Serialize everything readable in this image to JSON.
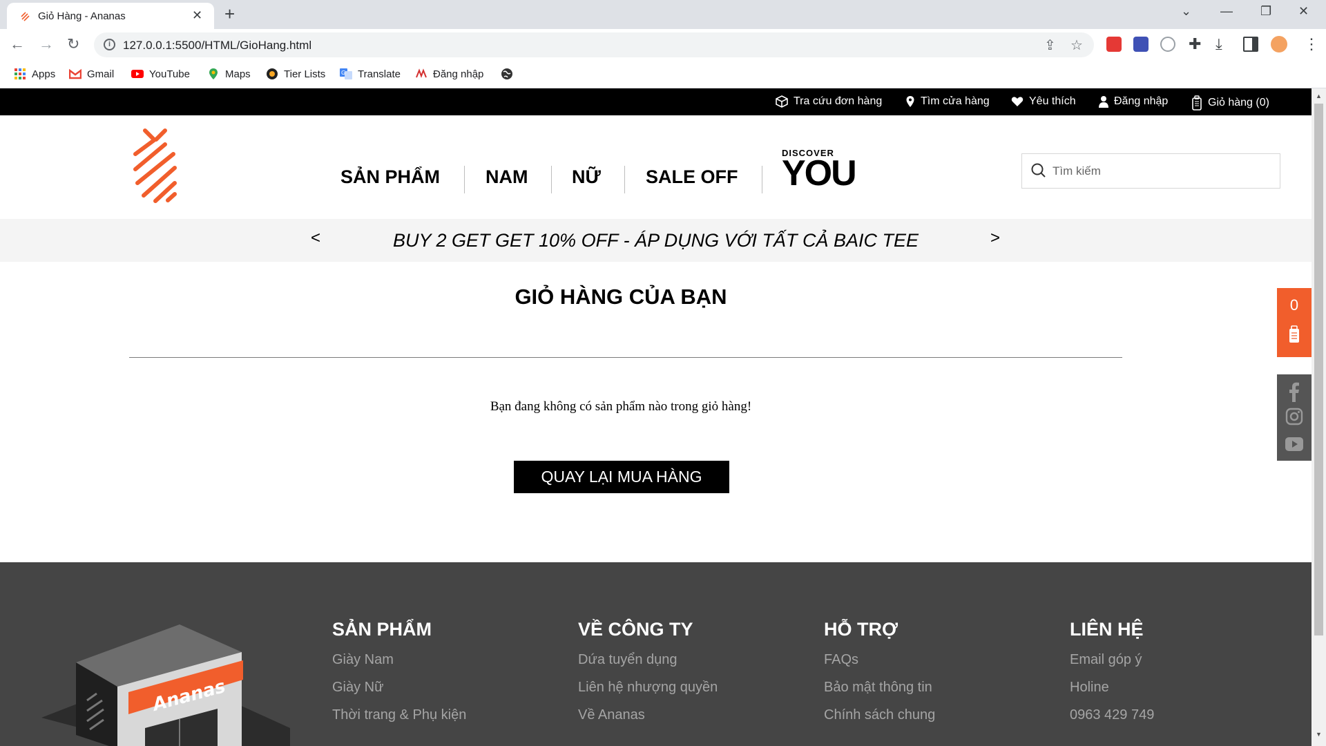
{
  "browser": {
    "tab_title": "Giỏ Hàng - Ananas",
    "url": "127.0.0.1:5500/HTML/GioHang.html",
    "bookmarks": [
      "Apps",
      "Gmail",
      "YouTube",
      "Maps",
      "Tier Lists",
      "Translate",
      "Đăng nhập"
    ]
  },
  "topbar": {
    "order_lookup": "Tra cứu đơn hàng",
    "find_store": "Tìm cửa hàng",
    "favorites": "Yêu thích",
    "login": "Đăng nhập",
    "cart": "Giỏ hàng (0)"
  },
  "nav": {
    "items": [
      "SẢN PHẨM",
      "NAM",
      "NỮ",
      "SALE OFF"
    ],
    "discover_small": "DISCOVER",
    "discover_big": "YOU"
  },
  "search": {
    "placeholder": "Tìm kiếm"
  },
  "promo": {
    "prev": "<",
    "text": "BUY 2 GET GET 10% OFF - ÁP DỤNG VỚI TẤT CẢ BAIC TEE",
    "next": ">"
  },
  "cart": {
    "title": "GIỎ HÀNG CỦA BẠN",
    "empty_message": "Bạn đang không có sản phẩm nào trong giỏ hàng!",
    "back_button": "QUAY LẠI MUA HÀNG",
    "floating_count": "0"
  },
  "footer": {
    "store_sign": "Ananas",
    "columns": [
      {
        "title": "SẢN PHẨM",
        "links": [
          "Giày Nam",
          "Giày Nữ",
          "Thời trang & Phụ kiện"
        ]
      },
      {
        "title": "VỀ CÔNG TY",
        "links": [
          "Dứa tuyển dụng",
          "Liên hệ nhượng quyền",
          "Về Ananas"
        ]
      },
      {
        "title": "HỖ TRỢ",
        "links": [
          "FAQs",
          "Bảo mật thông tin",
          "Chính sách chung"
        ]
      },
      {
        "title": "LIÊN HỆ",
        "links": [
          "Email góp ý",
          "Holine",
          "0963 429 749"
        ]
      }
    ]
  },
  "colors": {
    "brand_orange": "#f15e2c",
    "footer_bg": "#454545",
    "topbar_bg": "#000000"
  }
}
